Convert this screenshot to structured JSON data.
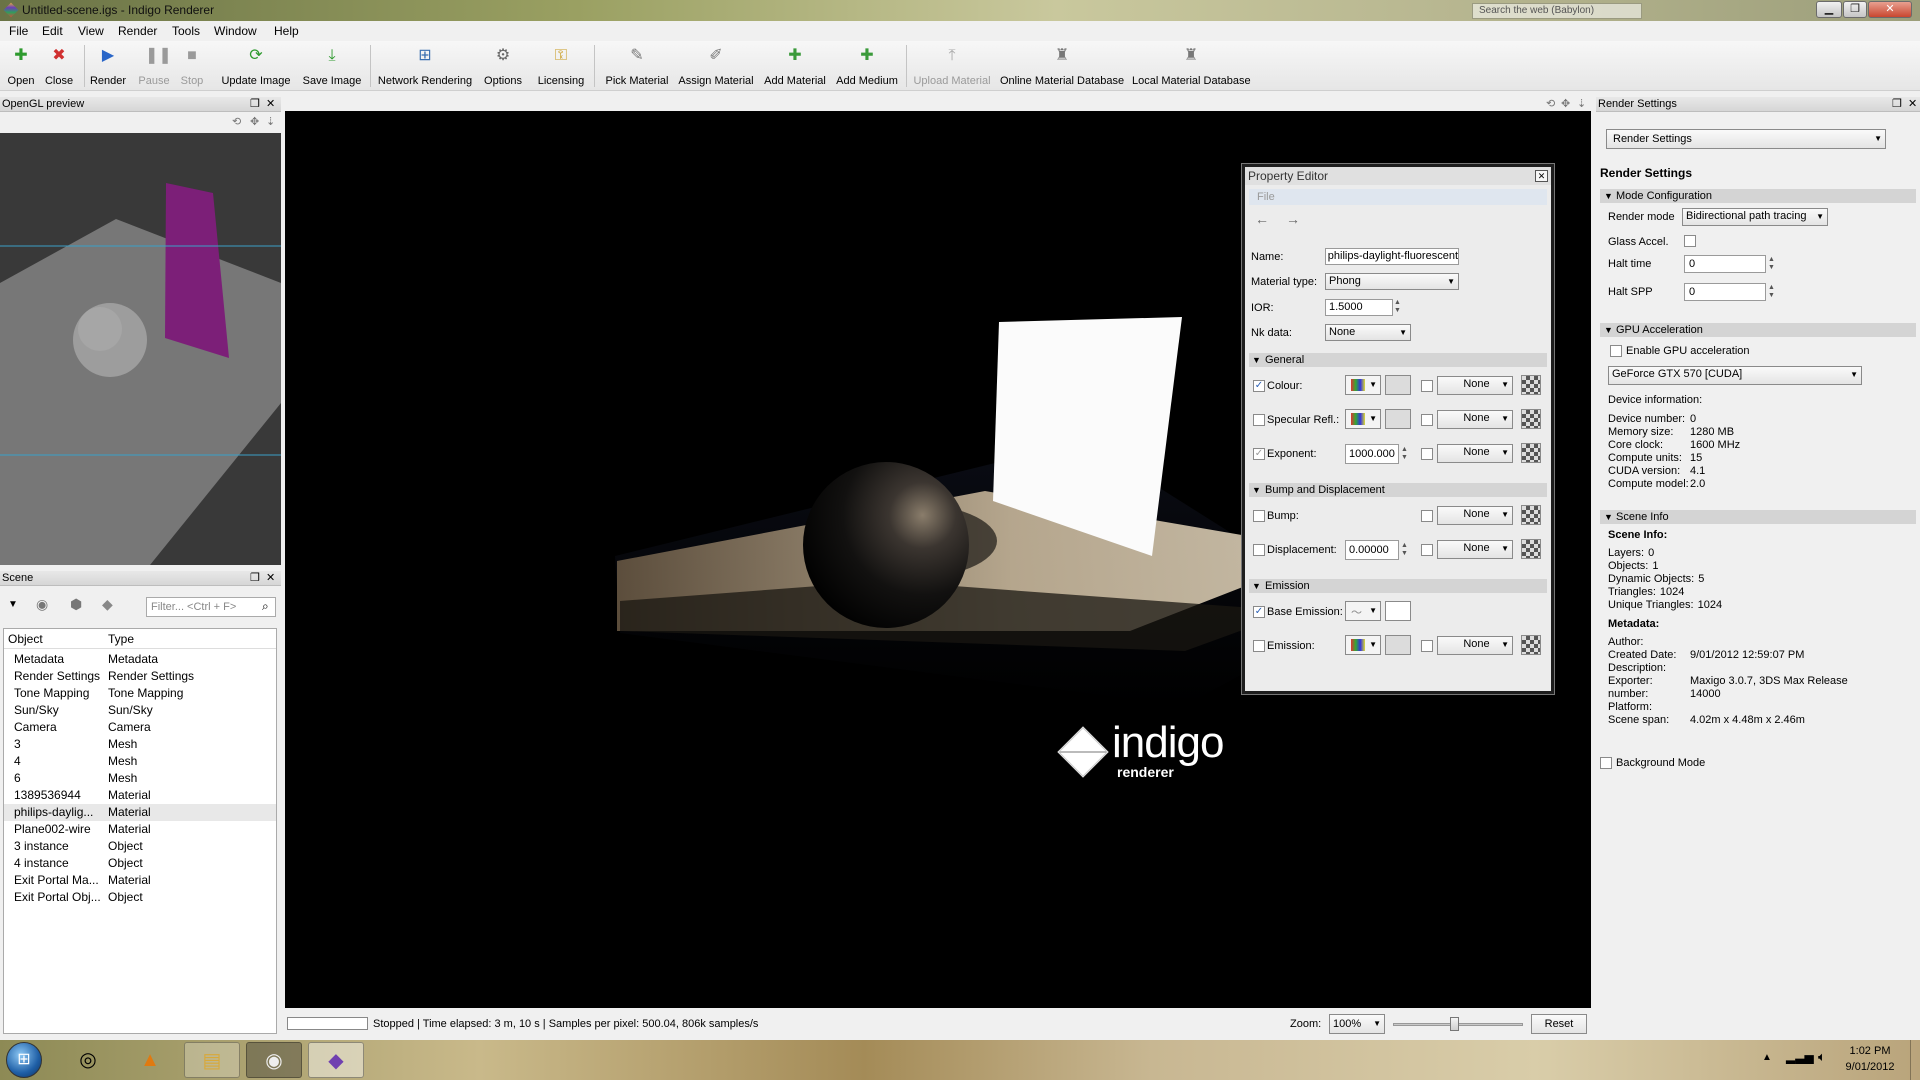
{
  "window": {
    "title": "Untitled-scene.igs - Indigo Renderer"
  },
  "browser_bar": {
    "search_placeholder": "Search the web (Babylon)"
  },
  "menu": [
    "File",
    "Edit",
    "View",
    "Render",
    "Tools",
    "Window",
    "Help"
  ],
  "toolbar": [
    {
      "label": "Open",
      "icon": "plus-icon",
      "glyph": "✚",
      "color": "#2e9a2e"
    },
    {
      "label": "Close",
      "icon": "close-icon",
      "glyph": "✖",
      "color": "#d03030"
    },
    {
      "label": "Render",
      "icon": "play-icon",
      "glyph": "▶",
      "color": "#2a66c8"
    },
    {
      "label": "Pause",
      "icon": "pause-icon",
      "glyph": "❚❚",
      "color": "#9a9a9a"
    },
    {
      "label": "Stop",
      "icon": "stop-icon",
      "glyph": "■",
      "color": "#9a9a9a"
    },
    {
      "label": "Update Image",
      "icon": "refresh-icon",
      "glyph": "⟳",
      "color": "#2e9a2e"
    },
    {
      "label": "Save Image",
      "icon": "download-icon",
      "glyph": "⤓",
      "color": "#2e9a2e"
    },
    {
      "label": "Network Rendering",
      "icon": "network-icon",
      "glyph": "⊞",
      "color": "#3a6fb0"
    },
    {
      "label": "Options",
      "icon": "gear-icon",
      "glyph": "⚙",
      "color": "#666"
    },
    {
      "label": "Licensing",
      "icon": "key-icon",
      "glyph": "⚿",
      "color": "#c89a1e"
    },
    {
      "label": "Pick Material",
      "icon": "eyedropper-icon",
      "glyph": "✎",
      "color": "#777"
    },
    {
      "label": "Assign Material",
      "icon": "brush-icon",
      "glyph": "✐",
      "color": "#777"
    },
    {
      "label": "Add Material",
      "icon": "add-material-icon",
      "glyph": "✚",
      "color": "#3a9a3a"
    },
    {
      "label": "Add Medium",
      "icon": "add-medium-icon",
      "glyph": "✚",
      "color": "#3a9a3a"
    },
    {
      "label": "Upload Material",
      "icon": "upload-icon",
      "glyph": "⤒",
      "color": "#aaa"
    },
    {
      "label": "Online Material Database",
      "icon": "online-db-icon",
      "glyph": "♜",
      "color": "#777"
    },
    {
      "label": "Local Material Database",
      "icon": "local-db-icon",
      "glyph": "♜",
      "color": "#777"
    }
  ],
  "opengl_panel": {
    "title": "OpenGL preview"
  },
  "scene_panel": {
    "title": "Scene",
    "filter_placeholder": "Filter... <Ctrl + F>",
    "columns": [
      "Object",
      "Type"
    ],
    "rows": [
      {
        "object": "Metadata",
        "type": "Metadata"
      },
      {
        "object": "Render Settings",
        "type": "Render Settings"
      },
      {
        "object": "Tone Mapping",
        "type": "Tone Mapping"
      },
      {
        "object": "Sun/Sky",
        "type": "Sun/Sky"
      },
      {
        "object": "Camera",
        "type": "Camera"
      },
      {
        "object": "3",
        "type": "Mesh"
      },
      {
        "object": "4",
        "type": "Mesh"
      },
      {
        "object": "6",
        "type": "Mesh"
      },
      {
        "object": "1389536944",
        "type": "Material"
      },
      {
        "object": "philips-daylig...",
        "type": "Material",
        "selected": true
      },
      {
        "object": "Plane002-wire",
        "type": "Material"
      },
      {
        "object": "3 instance",
        "type": "Object"
      },
      {
        "object": "4 instance",
        "type": "Object"
      },
      {
        "object": "Exit Portal Ma...",
        "type": "Material"
      },
      {
        "object": "Exit Portal Obj...",
        "type": "Object"
      }
    ]
  },
  "viewport": {
    "logo_text": "indigo",
    "logo_sub": "renderer"
  },
  "status": {
    "text": "Stopped | Time elapsed: 3 m, 10 s | Samples per pixel: 500.04, 806k samples/s",
    "zoom_label": "Zoom:",
    "zoom_value": "100%",
    "reset_label": "Reset"
  },
  "property_editor": {
    "title": "Property Editor",
    "file_menu": "File",
    "name_label": "Name:",
    "name_value": "philips-daylight-fluorescent",
    "material_type_label": "Material type:",
    "material_type_value": "Phong",
    "ior_label": "IOR:",
    "ior_value": "1.5000",
    "nk_label": "Nk data:",
    "nk_value": "None",
    "sections": {
      "general": "General",
      "bump": "Bump and Displacement",
      "emission": "Emission"
    },
    "colour_label": "Colour:",
    "spec_label": "Specular Refl.:",
    "exponent_label": "Exponent:",
    "exponent_value": "1000.000",
    "bump_label": "Bump:",
    "disp_label": "Displacement:",
    "disp_value": "0.00000",
    "base_emission_label": "Base Emission:",
    "emission_label": "Emission:",
    "none": "None"
  },
  "render_settings": {
    "panel_title": "Render Settings",
    "dropdown": "Render Settings",
    "heading": "Render Settings",
    "mode_section": "Mode Configuration",
    "render_mode_label": "Render mode",
    "render_mode_value": "Bidirectional path tracing",
    "glass_label": "Glass Accel.",
    "halt_time_label": "Halt time",
    "halt_time_value": "0",
    "halt_spp_label": "Halt SPP",
    "halt_spp_value": "0",
    "gpu_section": "GPU Acceleration",
    "enable_gpu_label": "Enable GPU acceleration",
    "gpu_device": "GeForce GTX 570 [CUDA]",
    "device_info_label": "Device information:",
    "device_info": [
      {
        "k": "Device number:",
        "v": "0"
      },
      {
        "k": "Memory size:",
        "v": "1280 MB"
      },
      {
        "k": "Core clock:",
        "v": "1600 MHz"
      },
      {
        "k": "Compute units:",
        "v": "15"
      },
      {
        "k": "CUDA version:",
        "v": "4.1"
      },
      {
        "k": "Compute model:",
        "v": "2.0"
      }
    ],
    "scene_info_section": "Scene Info",
    "scene_info_heading": "Scene Info:",
    "scene_info": [
      {
        "k": "Layers:",
        "v": "0"
      },
      {
        "k": "Objects:",
        "v": "1"
      },
      {
        "k": "Dynamic Objects:",
        "v": "5"
      },
      {
        "k": "Triangles:",
        "v": "1024"
      },
      {
        "k": "Unique Triangles:",
        "v": "1024"
      }
    ],
    "metadata_heading": "Metadata:",
    "metadata": [
      {
        "k": "Author:",
        "v": ""
      },
      {
        "k": "Created Date:",
        "v": "9/01/2012 12:59:07 PM"
      },
      {
        "k": "Description:",
        "v": ""
      },
      {
        "k": "Exporter:",
        "v": "Maxigo 3.0.7, 3DS Max Release"
      },
      {
        "k": "number:",
        "v": "14000"
      },
      {
        "k": "Platform:",
        "v": ""
      },
      {
        "k": "Scene span:",
        "v": "4.02m x 4.48m x 2.46m"
      }
    ],
    "background_mode_label": "Background Mode"
  },
  "taskbar": {
    "time": "1:02 PM",
    "date": "9/01/2012"
  }
}
